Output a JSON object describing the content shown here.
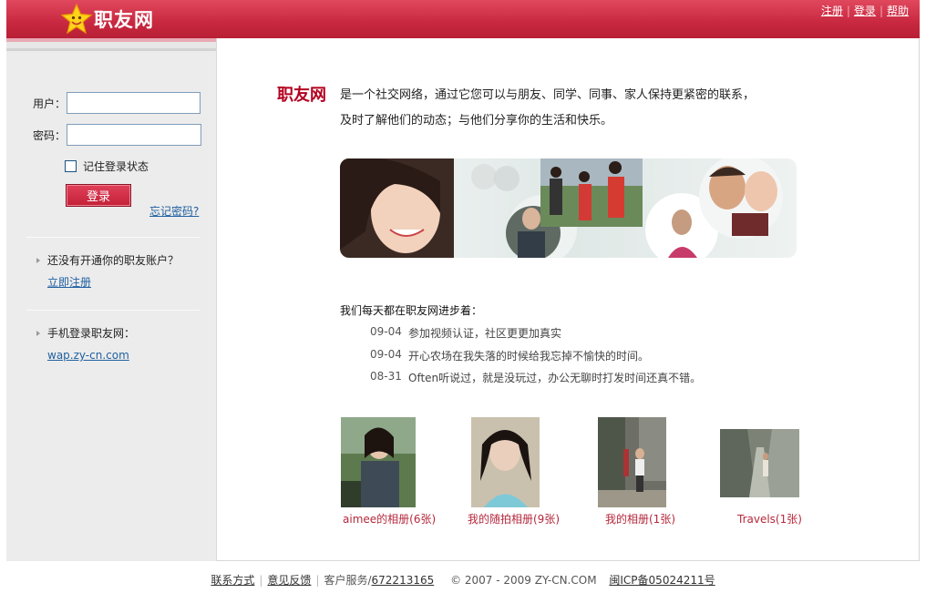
{
  "brand": {
    "name": "职友网"
  },
  "top_links": [
    {
      "label": "注册"
    },
    {
      "label": "登录"
    },
    {
      "label": "帮助"
    }
  ],
  "login": {
    "user_label": "用户：",
    "password_label": "密码：",
    "user_value": "",
    "password_value": "",
    "remember_label": "记住登录状态",
    "submit_label": "登录",
    "forgot_label": "忘记密码?"
  },
  "sidebar": {
    "no_account_text": "还没有开通你的职友账户？",
    "register_link": "立即注册",
    "mobile_text": "手机登录职友网：",
    "mobile_link": "wap.zy-cn.com"
  },
  "intro": {
    "brand": "职友网",
    "line1": "是一个社交网络，通过它您可以与朋友、同学、同事、家人保持更紧密的联系，",
    "line2": "及时了解他们的动态；与他们分享你的生活和快乐。"
  },
  "updates": {
    "title": "我们每天都在职友网进步着：",
    "items": [
      {
        "date": "09-04",
        "text": "参加视频认证，社区更更加真实"
      },
      {
        "date": "09-04",
        "text": "开心农场在我失落的时候给我忘掉不愉快的时间。"
      },
      {
        "date": "08-31",
        "text": "Often听说过，就是没玩过，办公无聊时打发时间还真不错。"
      }
    ]
  },
  "albums": [
    {
      "caption": "aimee的相册(6张)"
    },
    {
      "caption": "我的随拍相册(9张)"
    },
    {
      "caption": "我的相册(1张)"
    },
    {
      "caption": "Travels(1张)"
    }
  ],
  "footer": {
    "contact": "联系方式",
    "feedback": "意见反馈",
    "service_label": "客户服务/",
    "service_phone": "672213165",
    "copyright": "© 2007 - 2009  ZY-CN.COM",
    "icp": "闽ICP备05024211号"
  },
  "colors": {
    "brand_red": "#c8283f",
    "link_blue": "#2060a0",
    "caption_red": "#b5283c"
  }
}
